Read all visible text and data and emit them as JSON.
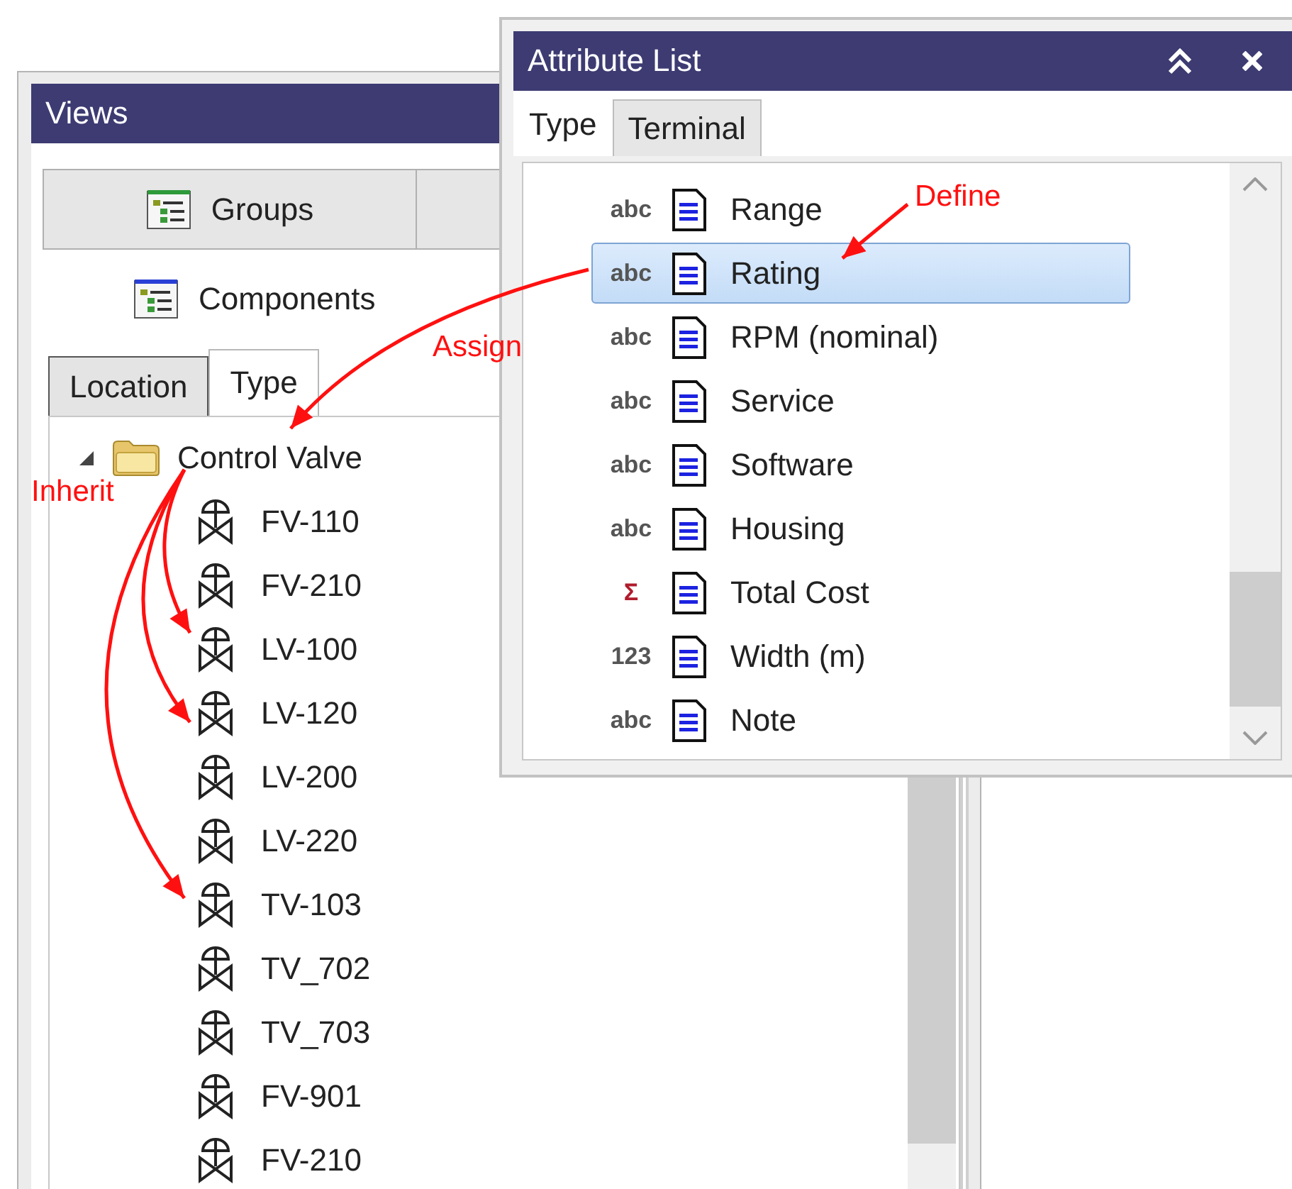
{
  "views": {
    "title": "Views",
    "group_tabs": [
      {
        "label": "Groups",
        "kind": "groups",
        "selected": false
      },
      {
        "label": "Components",
        "kind": "components",
        "selected": true
      }
    ],
    "sub_tabs": [
      {
        "label": "Location",
        "selected": false
      },
      {
        "label": "Type",
        "selected": true
      }
    ],
    "tree": [
      {
        "label": "Control Valve",
        "expanded": true,
        "children": [
          {
            "label": "FV-110"
          },
          {
            "label": "FV-210"
          },
          {
            "label": "LV-100"
          },
          {
            "label": "LV-120"
          },
          {
            "label": "LV-200"
          },
          {
            "label": "LV-220"
          },
          {
            "label": "TV-103"
          },
          {
            "label": "TV_702"
          },
          {
            "label": "TV_703"
          },
          {
            "label": "FV-901"
          },
          {
            "label": "FV-210"
          }
        ]
      }
    ]
  },
  "attribute_list": {
    "title": "Attribute List",
    "tabs": [
      {
        "label": "Type",
        "selected": true
      },
      {
        "label": "Terminal",
        "selected": false
      }
    ],
    "items": [
      {
        "type_label": "abc",
        "kind": "text",
        "name": "Range",
        "selected": false
      },
      {
        "type_label": "abc",
        "kind": "text",
        "name": "Rating",
        "selected": true
      },
      {
        "type_label": "abc",
        "kind": "text",
        "name": "RPM (nominal)",
        "selected": false
      },
      {
        "type_label": "abc",
        "kind": "text",
        "name": "Service",
        "selected": false
      },
      {
        "type_label": "abc",
        "kind": "text",
        "name": "Software",
        "selected": false
      },
      {
        "type_label": "abc",
        "kind": "text",
        "name": "Housing",
        "selected": false
      },
      {
        "type_label": "Σ",
        "kind": "sum",
        "name": "Total Cost",
        "selected": false
      },
      {
        "type_label": "123",
        "kind": "number",
        "name": "Width (m)",
        "selected": false
      },
      {
        "type_label": "abc",
        "kind": "text",
        "name": "Note",
        "selected": false
      }
    ]
  },
  "annotations": [
    {
      "text": "Define"
    },
    {
      "text": "Assign"
    },
    {
      "text": "Inherit"
    }
  ]
}
